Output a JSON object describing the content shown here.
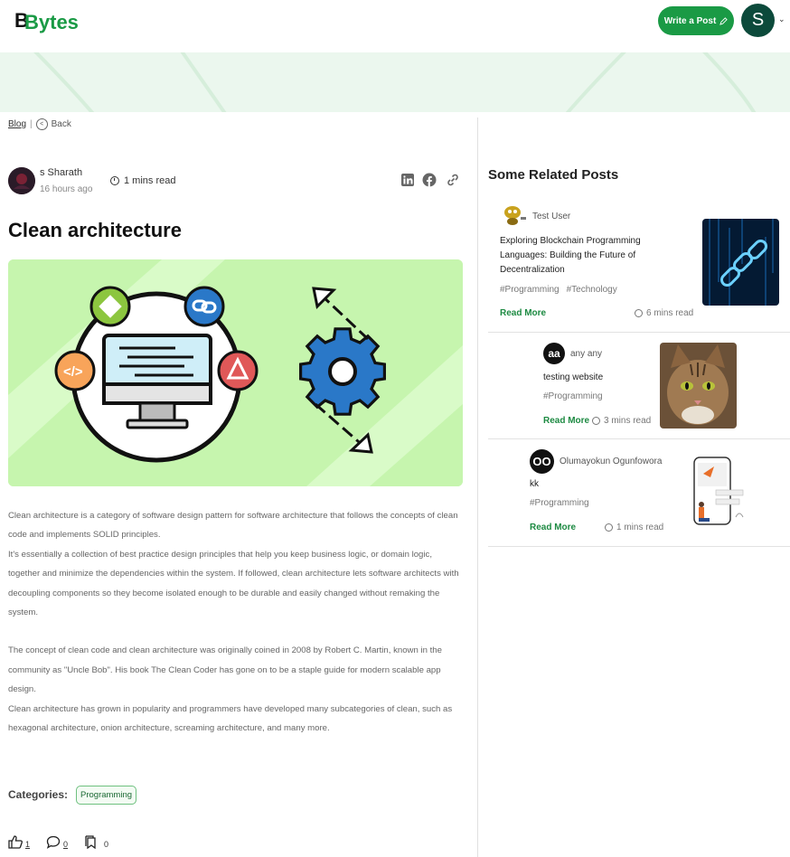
{
  "header": {
    "logo_text": "Bytes",
    "write_label": "Write a Post",
    "avatar_letter": "S",
    "brand_color": "#1a9a45"
  },
  "breadcrumb": {
    "blog": "Blog",
    "back": "Back"
  },
  "post": {
    "author_name": "s Sharath",
    "posted_ago": "16 hours ago",
    "read_time": "1 mins read",
    "title": "Clean architecture",
    "paragraphs": [
      "Clean architecture is a category of software design pattern for software architecture that follows the concepts of clean code and implements SOLID principles.",
      "It's essentially a collection of best practice design principles that help you keep business logic, or domain logic, together and minimize the dependencies within the system. If followed, clean architecture lets software architects with decoupling components so they become isolated enough to be durable and easily changed without remaking the system.",
      "",
      "The concept of clean code and clean architecture was originally coined in 2008 by Robert C. Martin, known in the community as \"Uncle Bob\". His book The Clean Coder has gone on to be a staple guide for modern scalable app design.",
      "Clean architecture has grown in popularity and programmers have developed many subcategories of clean, such as hexagonal architecture, onion architecture, screaming architecture, and many more."
    ],
    "categories_label": "Categories:",
    "category": "Programming",
    "likes": "1",
    "comments": "0",
    "bookmarks": "0",
    "share_icons": [
      "linkedin-icon",
      "facebook-icon",
      "link-icon"
    ]
  },
  "related": {
    "heading": "Some Related Posts",
    "posts": [
      {
        "user": "Test User",
        "title": "Exploring Blockchain Programming Languages: Building the Future of Decentralization",
        "tags": [
          "#Programming",
          "#Technology"
        ],
        "read_more": "Read More",
        "read_time": "6 mins read"
      },
      {
        "user": "any any",
        "avatar_text": "aa",
        "title": "testing website",
        "tags": [
          "#Programming"
        ],
        "read_more": "Read More",
        "read_time": "3 mins read"
      },
      {
        "user": "Olumayokun Ogunfowora",
        "avatar_text": "OO",
        "title": "kk",
        "tags": [
          "#Programming"
        ],
        "read_more": "Read More",
        "read_time": "1 mins read"
      }
    ]
  }
}
